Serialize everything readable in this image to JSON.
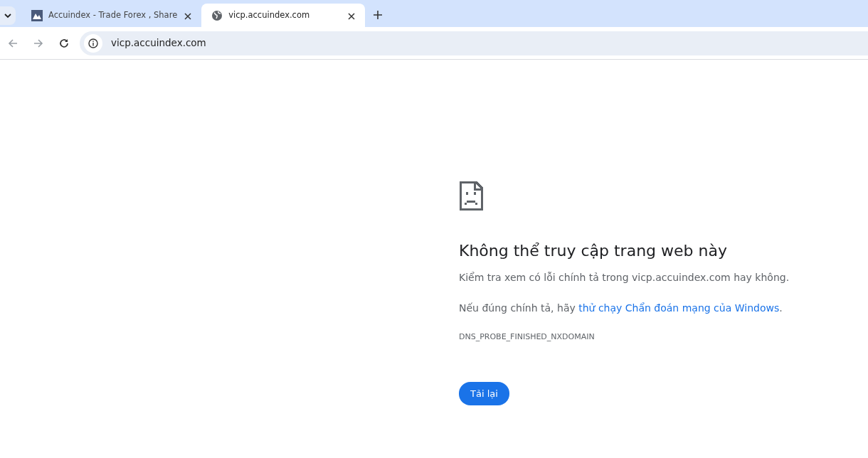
{
  "tabs": [
    {
      "title": "Accuindex - Trade Forex , Share",
      "selected": false,
      "kind": "site"
    },
    {
      "title": "vicp.accuindex.com",
      "selected": true,
      "kind": "error"
    }
  ],
  "address_bar": {
    "url": "vicp.accuindex.com"
  },
  "error": {
    "heading": "Không thể truy cập trang web này",
    "message": "Kiểm tra xem có lỗi chính tả trong vicp.accuindex.com hay không.",
    "suggestion": {
      "text": "Nếu đúng chính tả, hãy ",
      "link": "thử chạy Chẩn đoán mạng của Windows",
      "end": "."
    },
    "code": "DNS_PROBE_FINISHED_NXDOMAIN",
    "button": "Tải lại"
  }
}
